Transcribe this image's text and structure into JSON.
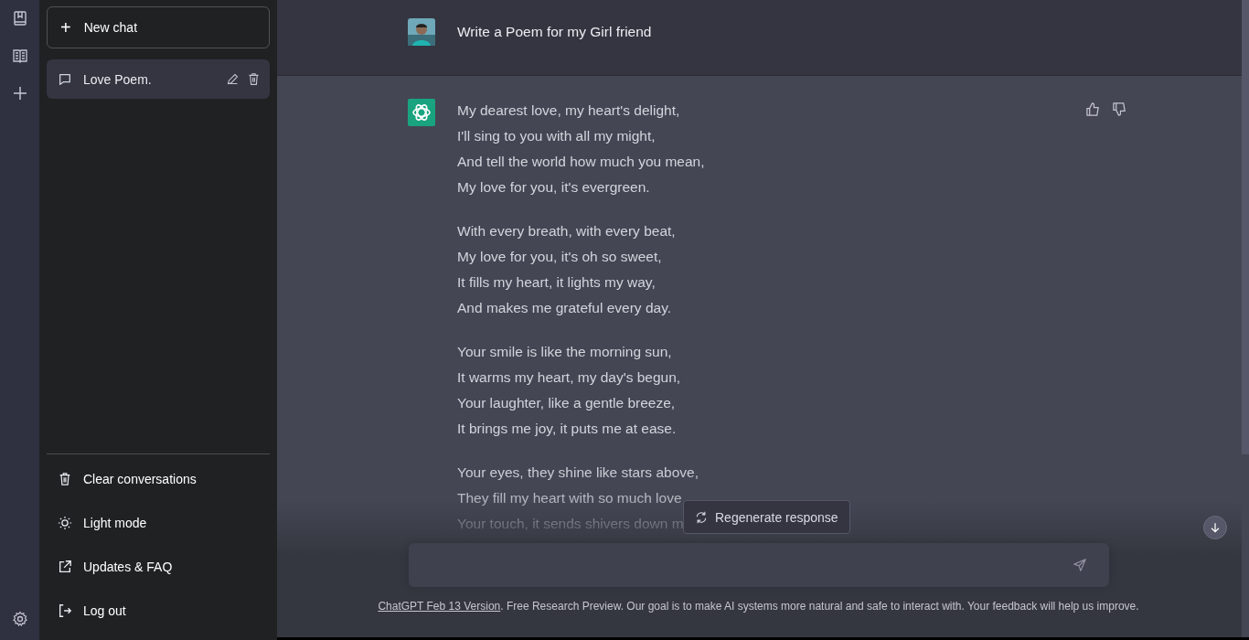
{
  "sidebar": {
    "new_chat": {
      "icon": "+",
      "label": "New chat"
    },
    "conversations": [
      {
        "title": "Love Poem.",
        "selected": true
      }
    ],
    "menu": [
      {
        "kind": "trash",
        "label": "Clear conversations"
      },
      {
        "kind": "sun",
        "label": "Light mode"
      },
      {
        "kind": "external",
        "label": "Updates & FAQ"
      },
      {
        "kind": "logout",
        "label": "Log out"
      }
    ]
  },
  "conversation": {
    "user_message": "Write a Poem for my Girl friend",
    "assistant_stanzas": [
      [
        "My dearest love, my heart's delight,",
        "I'll sing to you with all my might,",
        "And tell the world how much you mean,",
        "My love for you, it's evergreen."
      ],
      [
        "With every breath, with every beat,",
        "My love for you, it's oh so sweet,",
        "It fills my heart, it lights my way,",
        "And makes me grateful every day."
      ],
      [
        "Your smile is like the morning sun,",
        "It warms my heart, my day's begun,",
        "Your laughter, like a gentle breeze,",
        "It brings me joy, it puts me at ease."
      ],
      [
        "Your eyes, they shine like stars above,",
        "They fill my heart with so much love",
        "Your touch, it sends shivers down m"
      ]
    ]
  },
  "regenerate_button": "Regenerate response",
  "footer": {
    "link": "ChatGPT Feb 13 Version",
    "text": ". Free Research Preview. Our goal is to make AI systems more natural and safe to interact with. Your feedback will help us improve."
  }
}
